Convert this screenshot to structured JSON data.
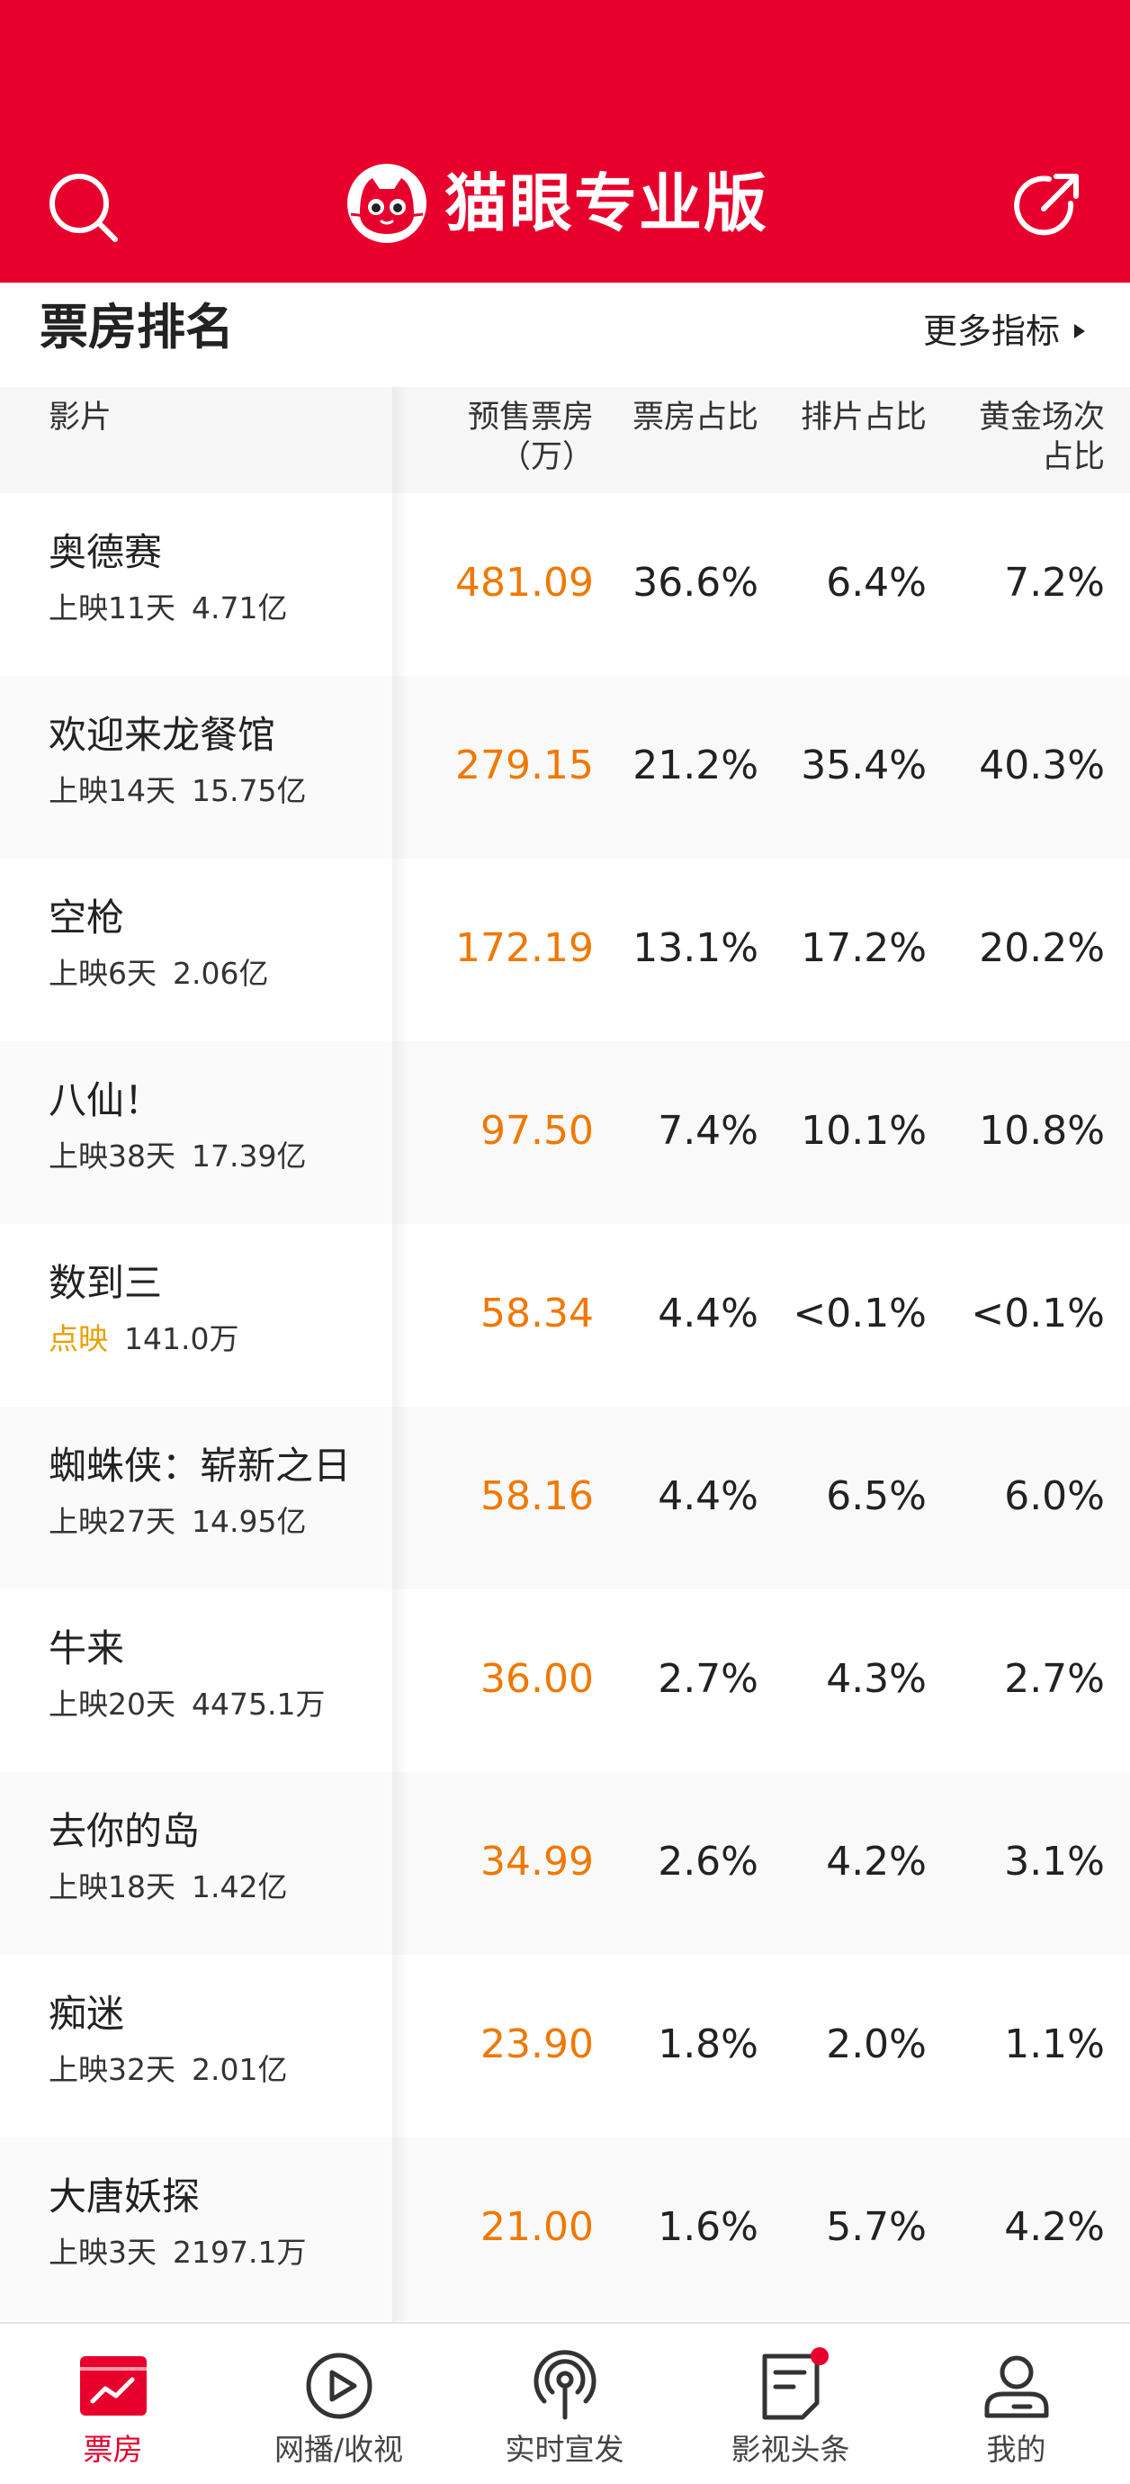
{
  "header": {
    "title": "猫眼专业版",
    "brand_color": "#E8002D",
    "left_icon": "search-icon",
    "right_icon": "share-icon",
    "logo_icon": "cat-logo-icon"
  },
  "section": {
    "title": "票房排名",
    "more_label": "更多指标"
  },
  "table": {
    "headers": {
      "film": "影片",
      "presale_line1": "预售票房",
      "presale_line2": "（万）",
      "share": "票房占比",
      "shows": "排片占比",
      "golden_line1": "黄金场次",
      "golden_line2": "占比"
    },
    "rows": [
      {
        "name": "奥德赛",
        "status": "上映11天",
        "gross": "4.71亿",
        "presale": "481.09",
        "share": "36.6%",
        "shows": "6.4%",
        "golden": "7.2%"
      },
      {
        "name": "欢迎来龙餐馆",
        "status": "上映14天",
        "gross": "15.75亿",
        "presale": "279.15",
        "share": "21.2%",
        "shows": "35.4%",
        "golden": "40.3%"
      },
      {
        "name": "空枪",
        "status": "上映6天",
        "gross": "2.06亿",
        "presale": "172.19",
        "share": "13.1%",
        "shows": "17.2%",
        "golden": "20.2%"
      },
      {
        "name": "八仙！",
        "status": "上映38天",
        "gross": "17.39亿",
        "presale": "97.50",
        "share": "7.4%",
        "shows": "10.1%",
        "golden": "10.8%"
      },
      {
        "name": "数到三",
        "status": "点映",
        "gross": "141.0万",
        "presale": "58.34",
        "share": "4.4%",
        "shows": "<0.1%",
        "golden": "<0.1%"
      },
      {
        "name": "蜘蛛侠：崭新之日",
        "status": "上映27天",
        "gross": "14.95亿",
        "presale": "58.16",
        "share": "4.4%",
        "shows": "6.5%",
        "golden": "6.0%"
      },
      {
        "name": "牛来",
        "status": "上映20天",
        "gross": "4475.1万",
        "presale": "36.00",
        "share": "2.7%",
        "shows": "4.3%",
        "golden": "2.7%"
      },
      {
        "name": "去你的岛",
        "status": "上映18天",
        "gross": "1.42亿",
        "presale": "34.99",
        "share": "2.6%",
        "shows": "4.2%",
        "golden": "3.1%"
      },
      {
        "name": "痴迷",
        "status": "上映32天",
        "gross": "2.01亿",
        "presale": "23.90",
        "share": "1.8%",
        "shows": "2.0%",
        "golden": "1.1%"
      },
      {
        "name": "大唐妖探",
        "status": "上映3天",
        "gross": "2197.1万",
        "presale": "21.00",
        "share": "1.6%",
        "shows": "5.7%",
        "golden": "4.2%"
      }
    ]
  },
  "tabbar": {
    "tabs": [
      {
        "label": "票房",
        "icon": "box-office-icon",
        "active": true
      },
      {
        "label": "网播/收视",
        "icon": "play-icon",
        "active": false
      },
      {
        "label": "实时宣发",
        "icon": "broadcast-icon",
        "active": false
      },
      {
        "label": "影视头条",
        "icon": "news-icon",
        "active": false,
        "badge": true
      },
      {
        "label": "我的",
        "icon": "profile-icon",
        "active": false
      }
    ]
  }
}
